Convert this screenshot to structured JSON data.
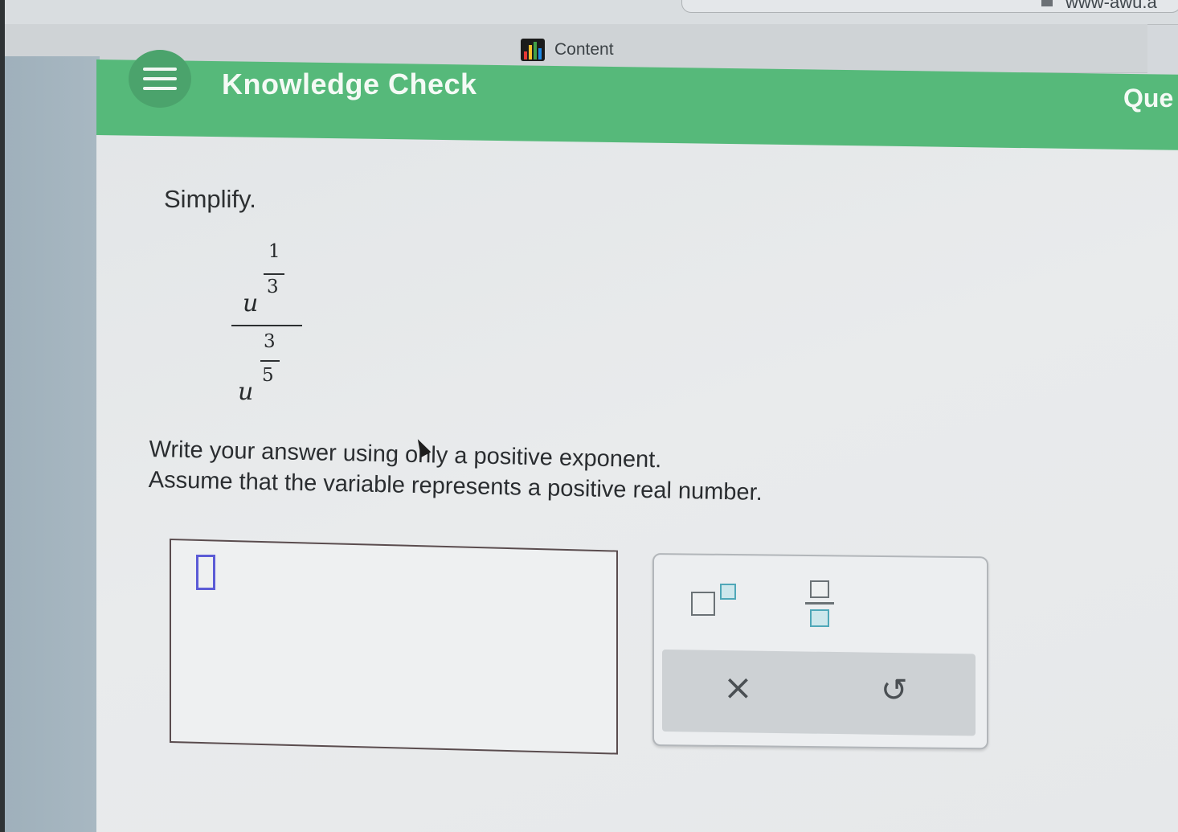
{
  "browser": {
    "url_fragment": "www-awu.a"
  },
  "tab": {
    "title": "Content",
    "icon": "bar-chart-icon"
  },
  "header": {
    "menu_icon": "hamburger-menu-icon",
    "title": "Knowledge Check",
    "right_label": "Que"
  },
  "question": {
    "prompt": "Simplify.",
    "expression": {
      "numerator_base": "u",
      "numerator_exponent": {
        "num": "1",
        "den": "3"
      },
      "denominator_base": "u",
      "denominator_exponent": {
        "num": "3",
        "den": "5"
      }
    },
    "instruction_line1": "Write your answer using only a positive exponent.",
    "instruction_line2": "Assume that the variable represents a positive real number."
  },
  "answer": {
    "value": ""
  },
  "tools": {
    "exponent_icon": "exponent-template-icon",
    "fraction_icon": "fraction-template-icon",
    "clear_label": "×",
    "undo_label": "↺",
    "accent_color": "#4fa7b8"
  },
  "colors": {
    "header_green": "#56b97a",
    "caret_blue": "#5b5bd6"
  }
}
